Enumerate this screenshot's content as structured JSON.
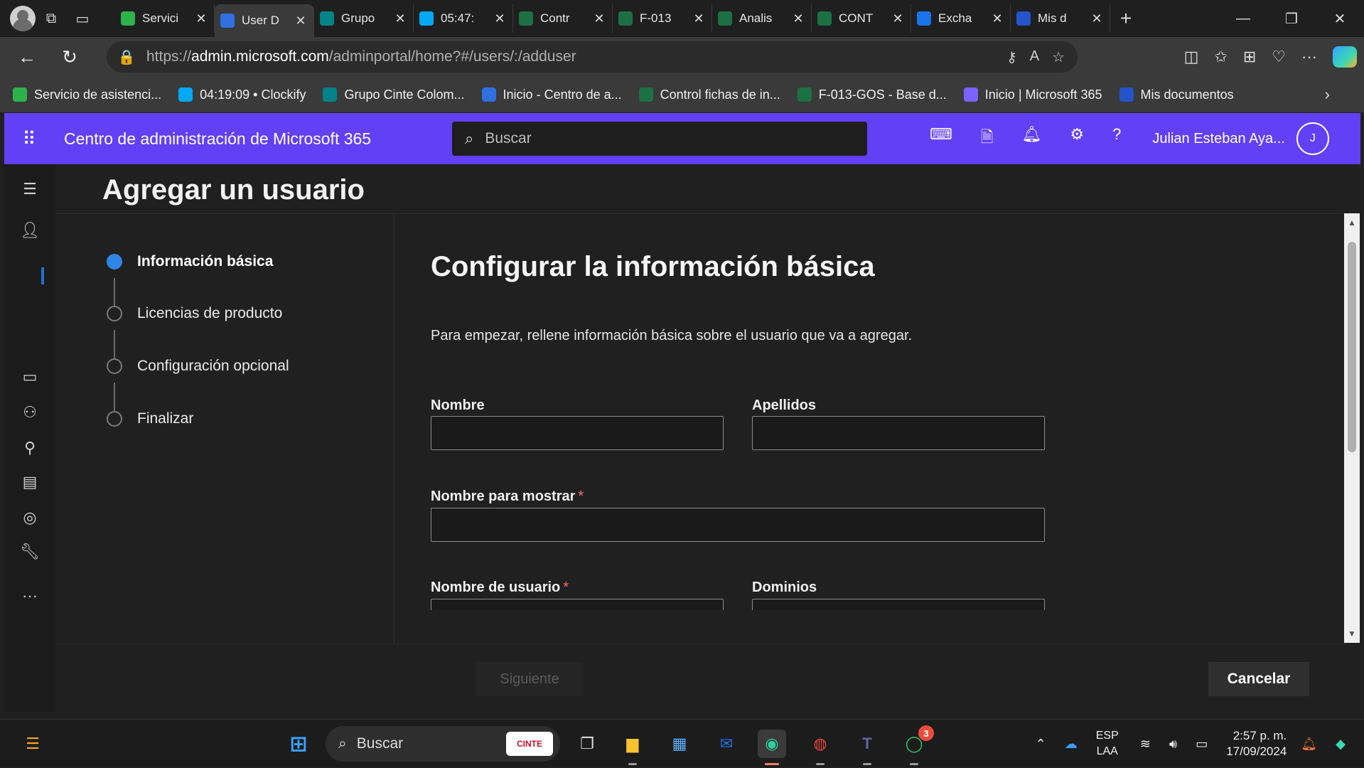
{
  "browser": {
    "tabs": [
      {
        "title": "Servici",
        "icon": "headset-icon",
        "color": "#2cb34a"
      },
      {
        "title": "User D",
        "icon": "azure-admin-icon",
        "color": "#2f6fe0",
        "active": true
      },
      {
        "title": "Grupo",
        "icon": "sharepoint-icon",
        "color": "#038387"
      },
      {
        "title": "05:47:",
        "icon": "clockify-icon",
        "color": "#03a9f4"
      },
      {
        "title": "Contr",
        "icon": "excel-icon",
        "color": "#1d7044"
      },
      {
        "title": "F-013",
        "icon": "excel-icon",
        "color": "#1d7044"
      },
      {
        "title": "Analis",
        "icon": "excel-icon",
        "color": "#1d7044"
      },
      {
        "title": "CONT",
        "icon": "excel-icon",
        "color": "#1d7044"
      },
      {
        "title": "Excha",
        "icon": "exchange-icon",
        "color": "#1a73e8"
      },
      {
        "title": "Mis d",
        "icon": "documents-icon",
        "color": "#2454c9"
      }
    ],
    "url_prefix": "https://",
    "url_host": "admin.microsoft.com",
    "url_path": "/adminportal/home?#/users/:/adduser",
    "bookmarks": [
      {
        "label": "Servicio de asistenci...",
        "color": "#2cb34a"
      },
      {
        "label": "04:19:09 • Clockify",
        "color": "#03a9f4"
      },
      {
        "label": "Grupo Cinte Colom...",
        "color": "#038387"
      },
      {
        "label": "Inicio - Centro de a...",
        "color": "#2f6fe0"
      },
      {
        "label": "Control fichas de in...",
        "color": "#1d7044"
      },
      {
        "label": "F-013-GOS - Base d...",
        "color": "#1d7044"
      },
      {
        "label": "Inicio | Microsoft 365",
        "color": "#7b61ff"
      },
      {
        "label": "Mis documentos",
        "color": "#2454c9"
      }
    ]
  },
  "header": {
    "app_title": "Centro de administración de Microsoft 365",
    "search_placeholder": "Buscar",
    "user_name": "Julian Esteban Aya...",
    "avatar_initial": "J",
    "accent": "#6240f5"
  },
  "page": {
    "title": "Agregar un usuario",
    "steps": [
      {
        "label": "Información básica",
        "active": true
      },
      {
        "label": "Licencias de producto",
        "active": false
      },
      {
        "label": "Configuración opcional",
        "active": false
      },
      {
        "label": "Finalizar",
        "active": false
      }
    ],
    "form": {
      "title": "Configurar la información básica",
      "description": "Para empezar, rellene información básica sobre el usuario que va a agregar.",
      "first_name_label": "Nombre",
      "first_name_value": "",
      "last_name_label": "Apellidos",
      "last_name_value": "",
      "display_name_label": "Nombre para mostrar",
      "display_name_value": "",
      "username_label": "Nombre de usuario",
      "domains_label": "Dominios",
      "required_mark": "*"
    },
    "buttons": {
      "next": "Siguiente",
      "cancel": "Cancelar"
    }
  },
  "taskbar": {
    "search_placeholder": "Buscar",
    "search_badge": "CINTE",
    "language": "ESP",
    "layout": "LAA",
    "time": "2:57 p. m.",
    "date": "17/09/2024",
    "whatsapp_badge": "3"
  }
}
